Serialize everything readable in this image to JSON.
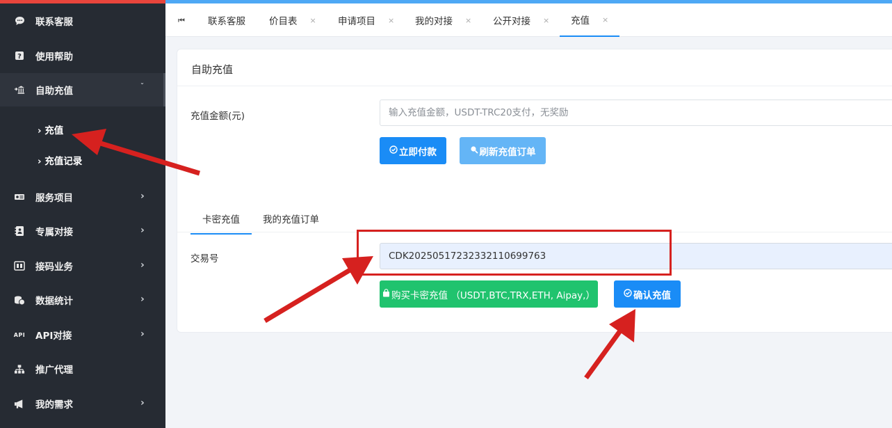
{
  "sidebar": {
    "items": [
      {
        "label": "联系客服",
        "icon": "chat-bubble-icon",
        "chevron": false
      },
      {
        "label": "使用帮助",
        "icon": "question-icon",
        "chevron": false
      },
      {
        "label": "自助充值",
        "icon": "bank-icon",
        "chevron": true,
        "chevron_glyph": "ˇ",
        "expanded": true
      },
      {
        "label": "服务项目",
        "icon": "id-card-icon",
        "chevron": true,
        "chevron_glyph": "›"
      },
      {
        "label": "专属对接",
        "icon": "contacts-icon",
        "chevron": true,
        "chevron_glyph": "›"
      },
      {
        "label": "接码业务",
        "icon": "phone-code-icon",
        "chevron": true,
        "chevron_glyph": "›"
      },
      {
        "label": "数据统计",
        "icon": "coins-icon",
        "chevron": true,
        "chevron_glyph": "›"
      },
      {
        "label": "API对接",
        "icon": "api-icon",
        "icon_text": "API",
        "chevron": true,
        "chevron_glyph": "›"
      },
      {
        "label": "推广代理",
        "icon": "sitemap-icon",
        "chevron": false
      },
      {
        "label": "我的需求",
        "icon": "megaphone-icon",
        "chevron": true,
        "chevron_glyph": "›"
      }
    ],
    "subitems": [
      {
        "label": "› 充值",
        "active": true
      },
      {
        "label": "› 充值记录",
        "active": false
      }
    ]
  },
  "tabs": {
    "first_glyph": "⏮",
    "close_glyph": "×",
    "items": [
      {
        "label": "联系客服",
        "closable": false
      },
      {
        "label": "价目表",
        "closable": true
      },
      {
        "label": "申请项目",
        "closable": true
      },
      {
        "label": "我的对接",
        "closable": true
      },
      {
        "label": "公开对接",
        "closable": true
      },
      {
        "label": "充值",
        "closable": true,
        "active": true
      }
    ]
  },
  "card": {
    "title": "自助充值",
    "amount_label": "充值金额(元)",
    "amount_placeholder": "输入充值金额，USDT-TRC20支付，无奖励",
    "pay_button": "立即付款",
    "refresh_button": "刷新充值订单",
    "subtabs": [
      "卡密充值",
      "我的充值订单"
    ],
    "txn_label": "交易号",
    "txn_value": "CDK202505172323321106997 63",
    "buy_button": "购买卡密充值 （USDT,BTC,TRX,ETH, Aipay,）",
    "confirm_button": "确认充值"
  },
  "colors": {
    "sidebar_bg": "#262b33",
    "accent_blue": "#1a8cf6",
    "light_blue": "#64b5f6",
    "green": "#20c36e",
    "annotation_red": "#d6211f"
  }
}
